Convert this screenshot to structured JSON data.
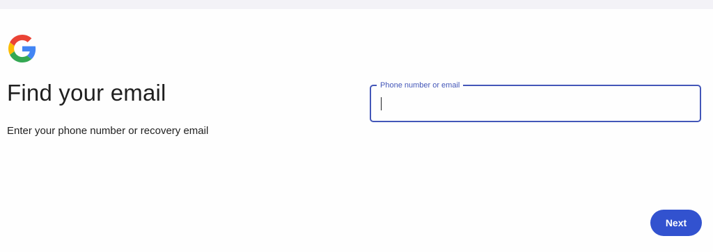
{
  "brand": {
    "logo_icon": "google-g-icon",
    "colors": {
      "blue": "#4285F4",
      "red": "#EA4335",
      "yellow": "#FBBC05",
      "green": "#34A853"
    }
  },
  "header": {
    "title": "Find your email",
    "subtitle": "Enter your phone number or recovery email"
  },
  "form": {
    "identifier": {
      "label": "Phone number or email",
      "value": "",
      "accent_color": "#4356b8"
    }
  },
  "actions": {
    "next_label": "Next",
    "next_color": "#3252cf"
  }
}
